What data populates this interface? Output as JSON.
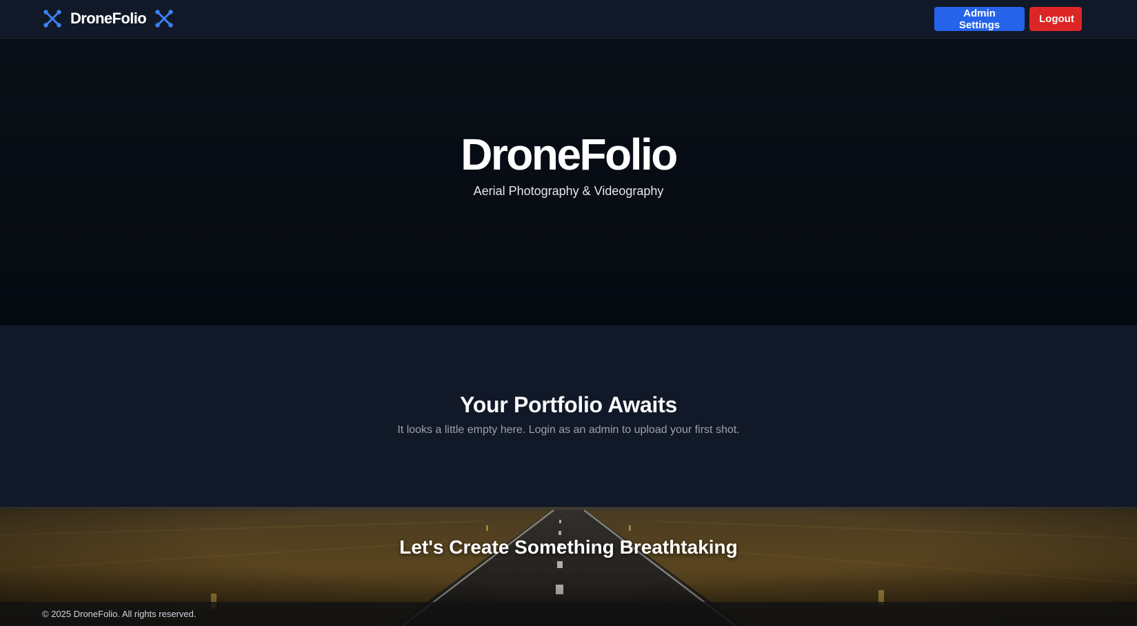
{
  "header": {
    "brand": "DroneFolio",
    "brand_icon": "drone-icon",
    "admin_button": "Admin Settings",
    "logout_button": "Logout"
  },
  "hero": {
    "title": "DroneFolio",
    "subtitle": "Aerial Photography & Videography"
  },
  "portfolio": {
    "title": "Your Portfolio Awaits",
    "description": "It looks a little empty here. Login as an admin to upload your first shot."
  },
  "cta": {
    "title": "Let's Create Something Breathtaking"
  },
  "footer": {
    "copyright": "© 2025 DroneFolio. All rights reserved."
  },
  "colors": {
    "accent": "#2563eb",
    "danger": "#dc2626",
    "icon": "#3b82f6",
    "header_bg": "#111827",
    "hero_bg": "#080c14"
  }
}
